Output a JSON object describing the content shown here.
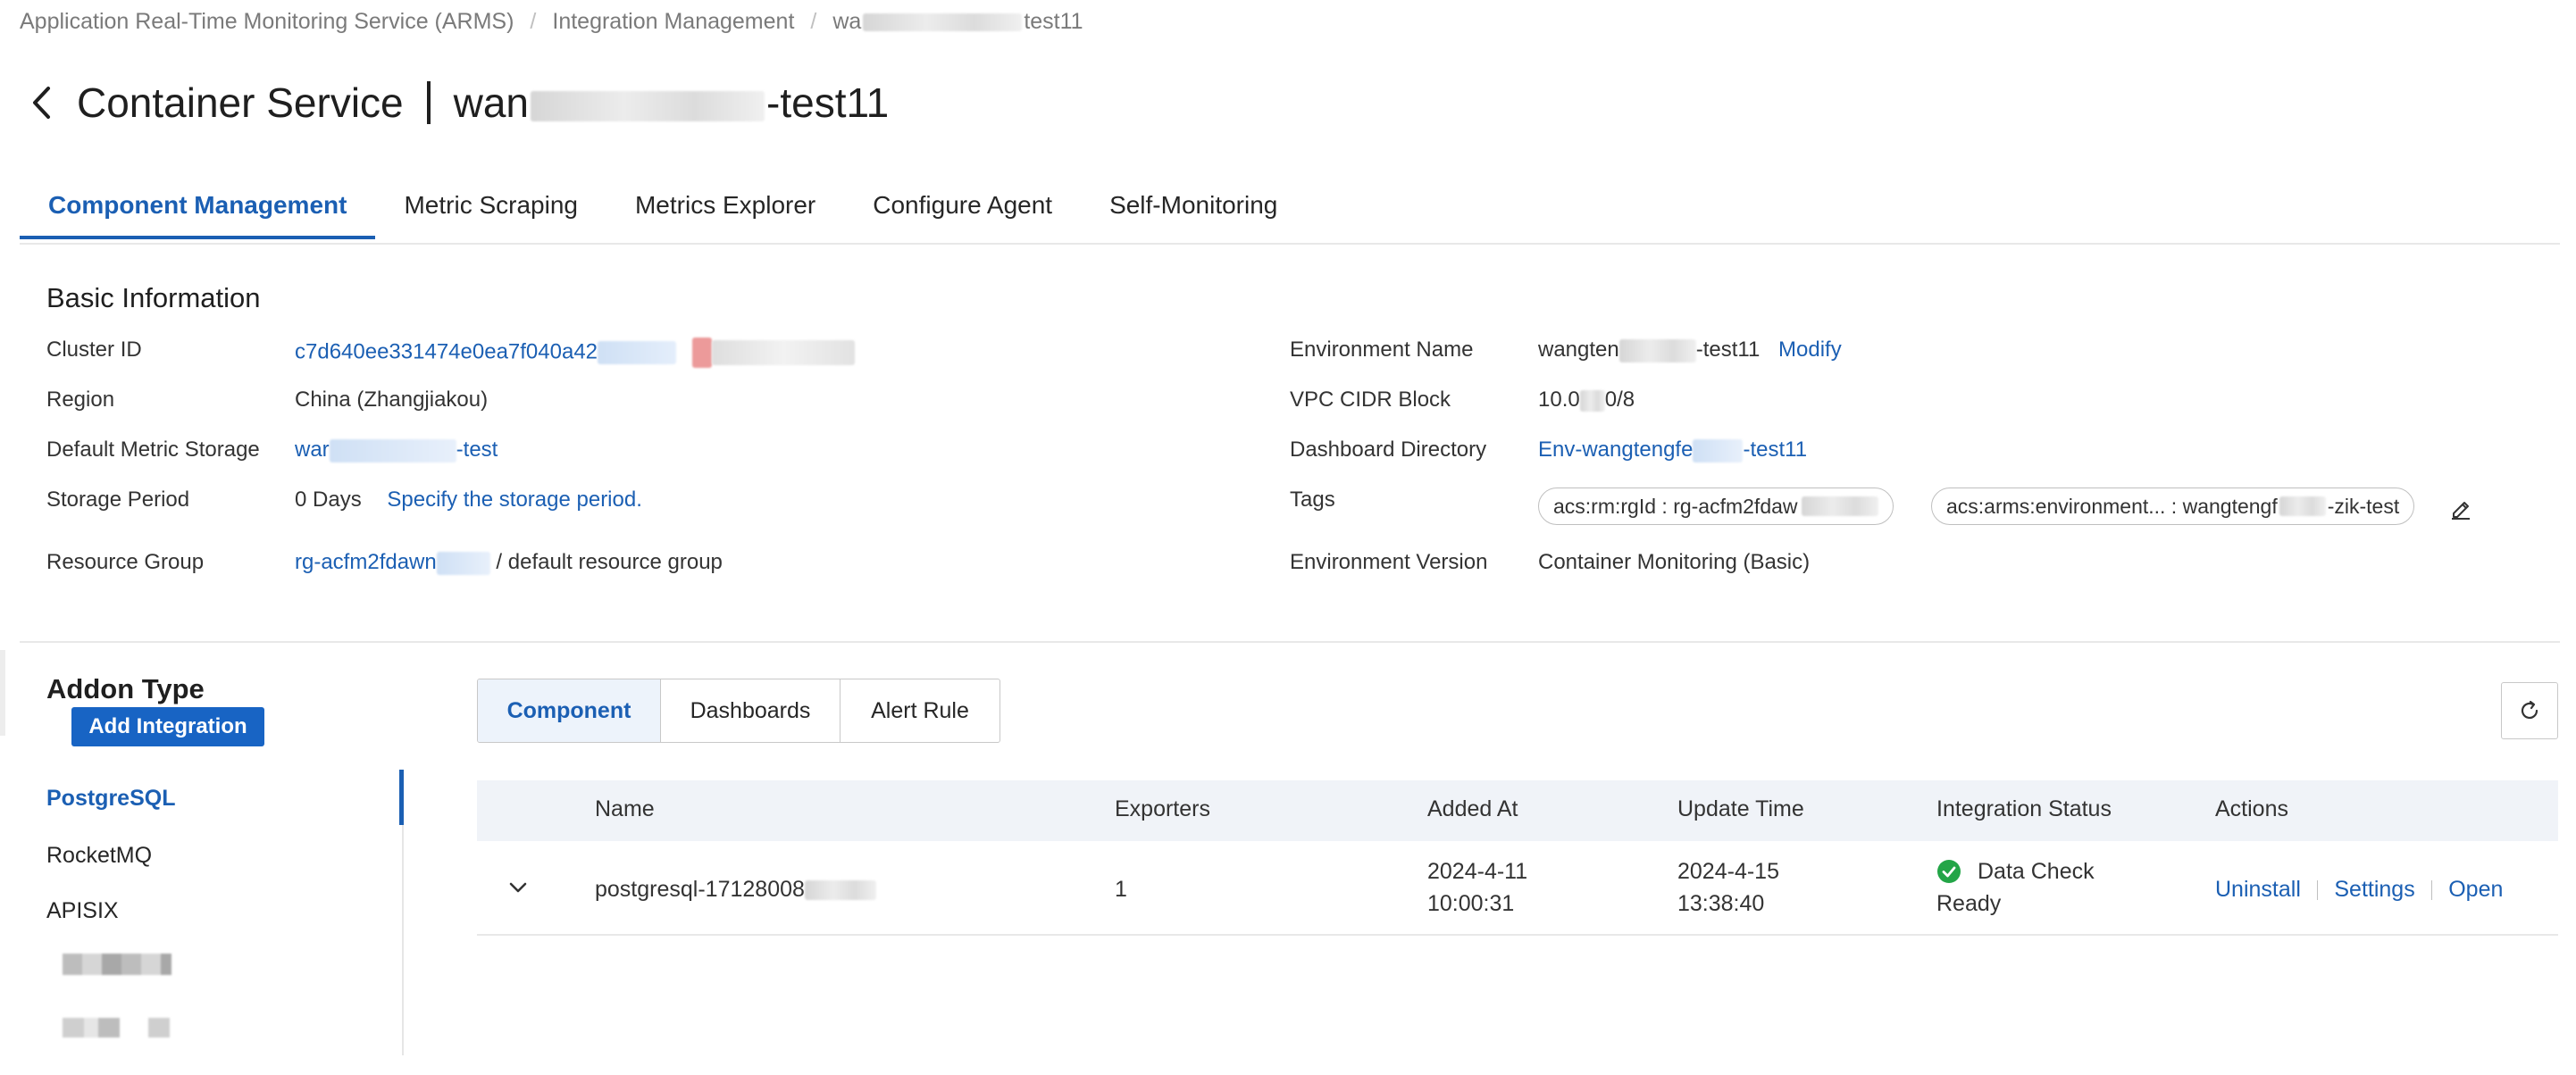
{
  "breadcrumb": {
    "items": [
      "Application Real-Time Monitoring Service (ARMS)",
      "Integration Management"
    ],
    "current_prefix": "wa",
    "current_suffix": "test11"
  },
  "header": {
    "title": "Container Service",
    "subtitle_prefix": "wan",
    "subtitle_suffix": "-test11"
  },
  "tabs": [
    {
      "label": "Component Management",
      "active": true
    },
    {
      "label": "Metric Scraping"
    },
    {
      "label": "Metrics Explorer"
    },
    {
      "label": "Configure Agent"
    },
    {
      "label": "Self-Monitoring"
    }
  ],
  "basic_info": {
    "title": "Basic Information",
    "cluster_id_label": "Cluster ID",
    "cluster_id_value": "c7d640ee331474e0ea7f040a42",
    "region_label": "Region",
    "region_value": "China (Zhangjiakou)",
    "metric_storage_label": "Default Metric Storage",
    "metric_storage_prefix": "war",
    "metric_storage_suffix": "-test",
    "storage_period_label": "Storage Period",
    "storage_period_value": "0 Days",
    "storage_period_link": "Specify the storage period.",
    "resource_group_label": "Resource Group",
    "resource_group_link": "rg-acfm2fdawn",
    "resource_group_suffix": "/ default resource group",
    "env_name_label": "Environment Name",
    "env_name_prefix": "wangten",
    "env_name_suffix": "-test11",
    "env_name_action": "Modify",
    "vpc_label": "VPC CIDR Block",
    "vpc_prefix": "10.0",
    "vpc_suffix": "0/8",
    "dashboard_dir_label": "Dashboard Directory",
    "dashboard_dir_prefix": "Env-wangtengfe",
    "dashboard_dir_suffix": "-test11",
    "tags_label": "Tags",
    "tags": [
      {
        "text": "acs:rm:rgId : rg-acfm2fdaw"
      },
      {
        "text": "acs:arms:environment... : wangtengf",
        "suffix": "-zik-test"
      }
    ],
    "env_version_label": "Environment Version",
    "env_version_value": "Container Monitoring (Basic)"
  },
  "addon": {
    "title": "Addon Type",
    "add_button": "Add Integration",
    "items": [
      "PostgreSQL",
      "RocketMQ",
      "APISIX"
    ],
    "active": "PostgreSQL"
  },
  "view_switch": {
    "items": [
      "Component",
      "Dashboards",
      "Alert Rule"
    ],
    "active": "Component"
  },
  "table": {
    "headers": [
      "Name",
      "Exporters",
      "Added At",
      "Update Time",
      "Integration Status",
      "Actions"
    ],
    "rows": [
      {
        "name": "postgresql-17128008",
        "exporters": "1",
        "added_date": "2024-4-11",
        "added_time": "10:00:31",
        "update_date": "2024-4-15",
        "update_time": "13:38:40",
        "status_line1": "Data Check",
        "status_line2": "Ready",
        "status_color": "#23a547",
        "actions": [
          "Uninstall",
          "Settings",
          "Open"
        ]
      }
    ]
  },
  "colors": {
    "accent": "#1b5fb3",
    "button_primary": "#1864c4",
    "success": "#23a547"
  },
  "icons": {
    "back": "chevron-left-icon",
    "edit": "pencil-icon",
    "refresh": "refresh-icon",
    "expand": "chevron-down-icon",
    "status": "check-circle-icon"
  }
}
